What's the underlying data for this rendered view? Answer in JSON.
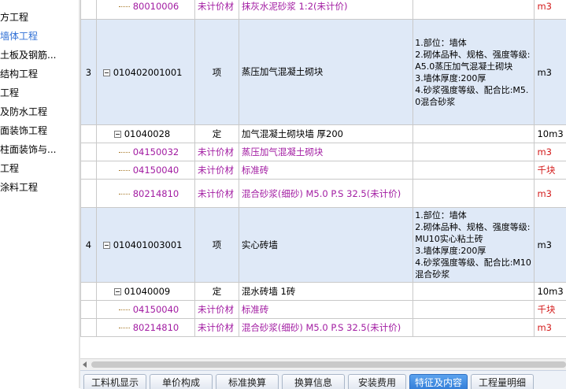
{
  "tree": {
    "items": [
      {
        "label": "方工程",
        "selected": false
      },
      {
        "label": "墙体工程",
        "selected": true
      },
      {
        "label": "土板及钢筋...",
        "selected": false
      },
      {
        "label": "结构工程",
        "selected": false
      },
      {
        "label": "工程",
        "selected": false
      },
      {
        "label": "及防水工程",
        "selected": false
      },
      {
        "label": "面装饰工程",
        "selected": false
      },
      {
        "label": "柱面装饰与...",
        "selected": false
      },
      {
        "label": "工程",
        "selected": false
      },
      {
        "label": "涂料工程",
        "selected": false
      }
    ]
  },
  "grid": {
    "rows": [
      {
        "kind": "mat",
        "seq": "",
        "code": "80010006",
        "type": "未计价材",
        "name": "抹灰水泥砂浆 1:2(未计价)",
        "feature": "",
        "unit": "m3"
      },
      {
        "kind": "item",
        "seq": "3",
        "code": "010402001001",
        "type": "项",
        "name": "蒸压加气混凝土砌块",
        "feature": "1.部位：墙体\n2.砌体品种、规格、强度等级:A5.0蒸压加气混凝土砌块\n3.墙体厚度:200厚\n4.砂浆强度等级、配合比:M5.0混合砂浆",
        "unit": "m3"
      },
      {
        "kind": "norm",
        "seq": "",
        "code": "01040028",
        "type": "定",
        "name": "加气混凝土砌块墙 厚200",
        "feature": "",
        "unit": "10m3"
      },
      {
        "kind": "mat",
        "seq": "",
        "code": "04150032",
        "type": "未计价材",
        "name": "蒸压加气混凝土砌块",
        "feature": "",
        "unit": "m3"
      },
      {
        "kind": "mat",
        "seq": "",
        "code": "04150040",
        "type": "未计价材",
        "name": "标准砖",
        "feature": "",
        "unit": "千块"
      },
      {
        "kind": "mat",
        "seq": "",
        "code": "80214810",
        "type": "未计价材",
        "name": "混合砂浆(细砂) M5.0 P.S 32.5(未计价)",
        "feature": "",
        "unit": "m3"
      },
      {
        "kind": "item",
        "seq": "4",
        "code": "010401003001",
        "type": "项",
        "name": "实心砖墙",
        "feature": "1.部位：墙体\n2.砌体品种、规格、强度等级:MU10实心粘土砖\n3.墙体厚度:200厚\n4.砂浆强度等级、配合比:M10混合砂浆",
        "unit": "m3"
      },
      {
        "kind": "norm",
        "seq": "",
        "code": "01040009",
        "type": "定",
        "name": "混水砖墙 1砖",
        "feature": "",
        "unit": "10m3"
      },
      {
        "kind": "mat",
        "seq": "",
        "code": "04150040",
        "type": "未计价材",
        "name": "标准砖",
        "feature": "",
        "unit": "千块"
      },
      {
        "kind": "mat",
        "seq": "",
        "code": "80214810",
        "type": "未计价材",
        "name": "混合砂浆(细砂) M5.0 P.S 32.5(未计价)",
        "feature": "",
        "unit": "m3"
      }
    ]
  },
  "tabs": [
    {
      "label": "工料机显示",
      "active": false
    },
    {
      "label": "单价构成",
      "active": false
    },
    {
      "label": "标准换算",
      "active": false
    },
    {
      "label": "换算信息",
      "active": false
    },
    {
      "label": "安装费用",
      "active": false
    },
    {
      "label": "特征及内容",
      "active": true
    },
    {
      "label": "工程量明细",
      "active": false
    }
  ],
  "colors": {
    "material_text": "#a21ca2",
    "unit_highlight": "#d31a1a",
    "item_row_bg": "#dfe9f7",
    "active_tab": "#2f7ad6"
  }
}
